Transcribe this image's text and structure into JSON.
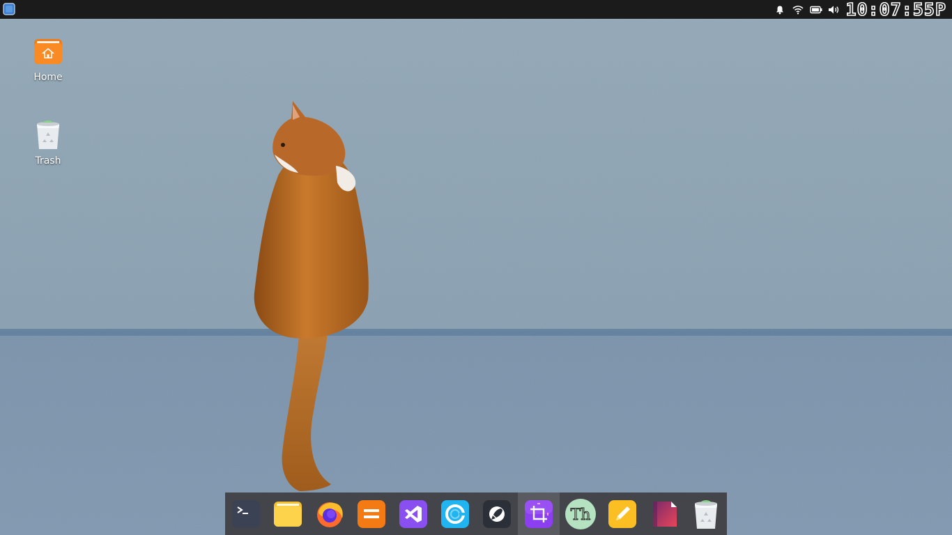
{
  "top_panel": {
    "clock": "10:07:55P",
    "tray_icons": [
      "bell-icon",
      "wifi-icon",
      "battery-icon",
      "volume-icon"
    ]
  },
  "desktop": {
    "icons": [
      {
        "label": "Home",
        "icon": "home-folder-icon"
      },
      {
        "label": "Trash",
        "icon": "trash-icon"
      }
    ],
    "wallpaper": "orange cat sitting on a blue-grey concrete wall"
  },
  "dock": {
    "items": [
      {
        "name": "terminal",
        "icon": "terminal-icon",
        "active": false
      },
      {
        "name": "files",
        "icon": "folder-icon",
        "active": false
      },
      {
        "name": "firefox",
        "icon": "firefox-icon",
        "active": false
      },
      {
        "name": "calculator",
        "icon": "calculator-icon",
        "active": false
      },
      {
        "name": "visual-studio-code",
        "icon": "vscode-icon",
        "active": false
      },
      {
        "name": "browser",
        "icon": "browser-icon",
        "active": false
      },
      {
        "name": "launcher",
        "icon": "rocket-icon",
        "active": false
      },
      {
        "name": "screenshot",
        "icon": "crop-icon",
        "active": true
      },
      {
        "name": "fonts",
        "icon": "font-icon",
        "active": false
      },
      {
        "name": "text-editor",
        "icon": "pencil-icon",
        "active": false
      },
      {
        "name": "document-viewer",
        "icon": "document-icon",
        "active": false
      },
      {
        "name": "trash",
        "icon": "trash-icon",
        "active": false
      }
    ]
  },
  "colors": {
    "panel": "#1b1b1b",
    "dock": "#3e3e42",
    "home_folder": "#f7811f",
    "wall": "#8fa5b5"
  }
}
